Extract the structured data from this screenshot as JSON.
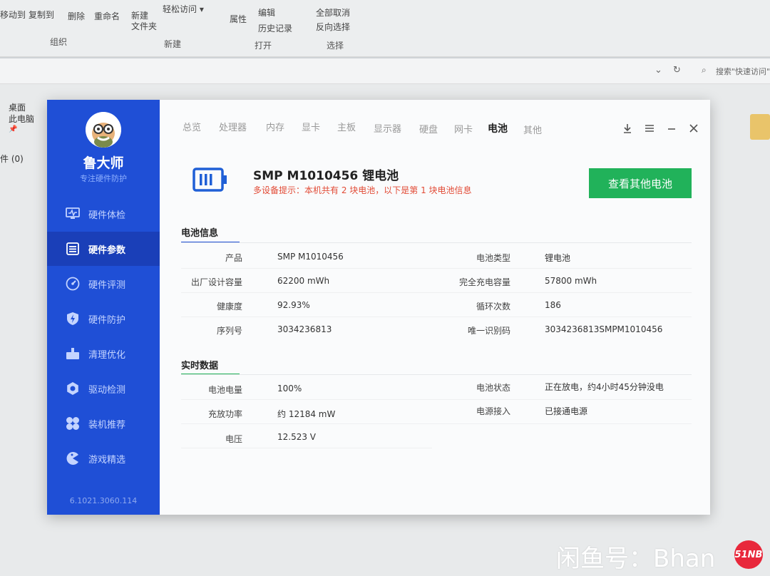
{
  "explorer": {
    "ribbon_items": {
      "move_to": "移动到",
      "copy_to": "复制到",
      "delete": "删除",
      "rename": "重命名",
      "new_folder": "新建\n文件夹",
      "easy_access": "轻松访问",
      "properties": "属性",
      "edit": "编辑",
      "history": "历史记录",
      "select_none": "全部取消",
      "invert_select": "反向选择"
    },
    "groups": {
      "organize": "组织",
      "new": "新建",
      "open": "打开",
      "select": "选择"
    },
    "search_placeholder": "搜索\"快速访问\"",
    "nav": {
      "desktop": "桌面",
      "this_pc": "此电脑",
      "count": "件 (0)"
    }
  },
  "app": {
    "brand": "鲁大师",
    "slogan": "专注硬件防护",
    "version": "6.1021.3060.114",
    "sidebar": [
      {
        "label": "硬件体检",
        "icon": "monitor-pulse-icon"
      },
      {
        "label": "硬件参数",
        "icon": "list-icon"
      },
      {
        "label": "硬件评测",
        "icon": "gauge-icon"
      },
      {
        "label": "硬件防护",
        "icon": "bolt-shield-icon"
      },
      {
        "label": "清理优化",
        "icon": "broom-icon"
      },
      {
        "label": "驱动检测",
        "icon": "gear-icon"
      },
      {
        "label": "装机推荐",
        "icon": "fan-icon"
      },
      {
        "label": "游戏精选",
        "icon": "gamepad-icon"
      }
    ],
    "active_nav_index": 1,
    "tabs": [
      "总览",
      "处理器",
      "内存",
      "显卡",
      "主板",
      "显示器",
      "硬盘",
      "网卡",
      "电池",
      "其他"
    ],
    "active_tab_index": 8,
    "battery": {
      "title": "SMP M1010456 锂电池",
      "warning": "多设备提示：本机共有 2 块电池，以下是第 1 块电池信息",
      "other_button": "查看其他电池"
    },
    "battery_info": {
      "section_title": "电池信息",
      "left": [
        {
          "label": "产品",
          "value": "SMP M1010456"
        },
        {
          "label": "出厂设计容量",
          "value": "62200 mWh"
        },
        {
          "label": "健康度",
          "value": "92.93%"
        },
        {
          "label": "序列号",
          "value": "3034236813"
        }
      ],
      "right": [
        {
          "label": "电池类型",
          "value": "锂电池"
        },
        {
          "label": "完全充电容量",
          "value": "57800 mWh"
        },
        {
          "label": "循环次数",
          "value": "186"
        },
        {
          "label": "唯一识别码",
          "value": "3034236813SMPM1010456"
        }
      ]
    },
    "realtime": {
      "section_title": "实时数据",
      "left": [
        {
          "label": "电池电量",
          "value": "100%"
        },
        {
          "label": "充放功率",
          "value": "约 12184 mW"
        },
        {
          "label": "电压",
          "value": "12.523 V"
        }
      ],
      "right": [
        {
          "label": "电池状态",
          "value": "正在放电，约4小时45分钟没电"
        },
        {
          "label": "电源接入",
          "value": "已接通电源"
        }
      ]
    }
  },
  "watermark": {
    "text": "闲鱼号：Bhan",
    "badge": "51NB"
  },
  "colors": {
    "sidebar": "#1f4fd6",
    "sidebar_active": "#1a3fb8",
    "accent_green": "#21b25a",
    "warning_red": "#e24b36"
  }
}
